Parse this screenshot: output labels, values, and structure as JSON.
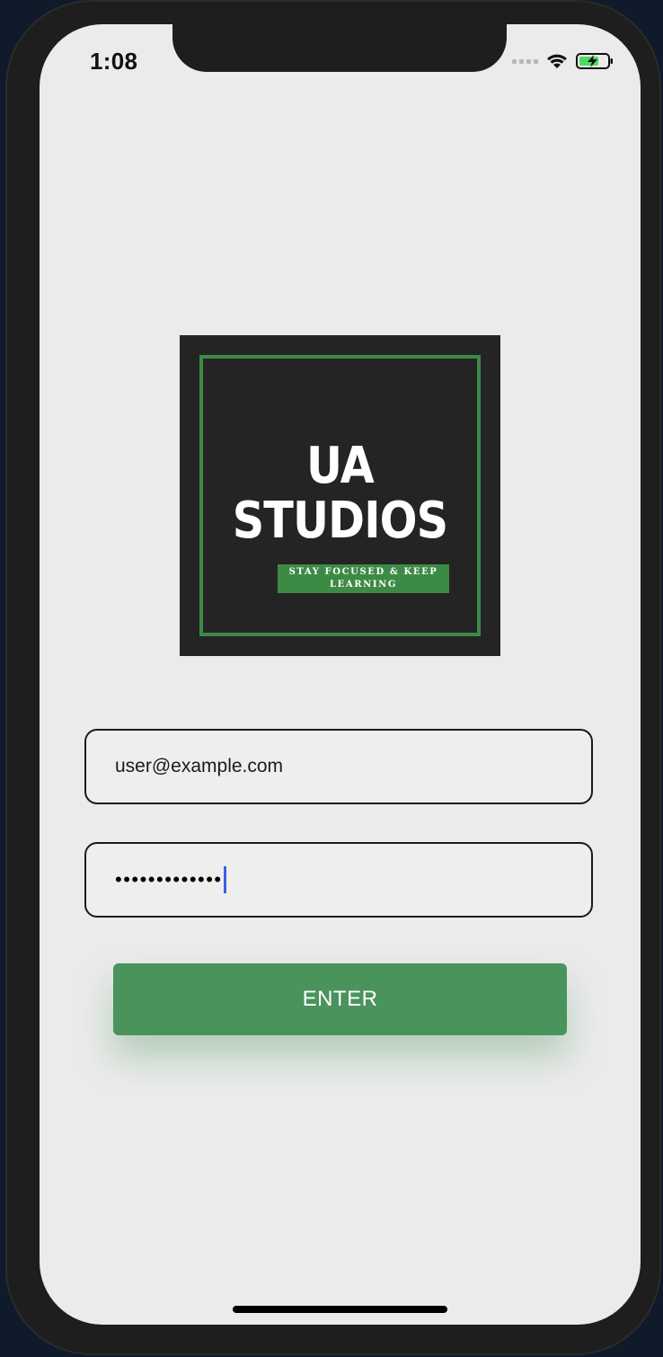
{
  "status_bar": {
    "time": "1:08",
    "icons": [
      "signal-icon",
      "wifi-icon",
      "battery-charging-icon"
    ]
  },
  "logo": {
    "line1": "UA",
    "line2": "STUDIOS",
    "tagline_line1": "STAY FOCUSED & KEEP",
    "tagline_line2": "LEARNING",
    "colors": {
      "background": "#242424",
      "accent": "#3d8a45",
      "text": "#ffffff"
    }
  },
  "form": {
    "email_value": "user@example.com",
    "password_value": "•••••••••••••",
    "enter_label": "ENTER"
  },
  "colors": {
    "screen_background": "#ebebeb",
    "button": "#4a935d",
    "caret": "#3b61e0"
  }
}
